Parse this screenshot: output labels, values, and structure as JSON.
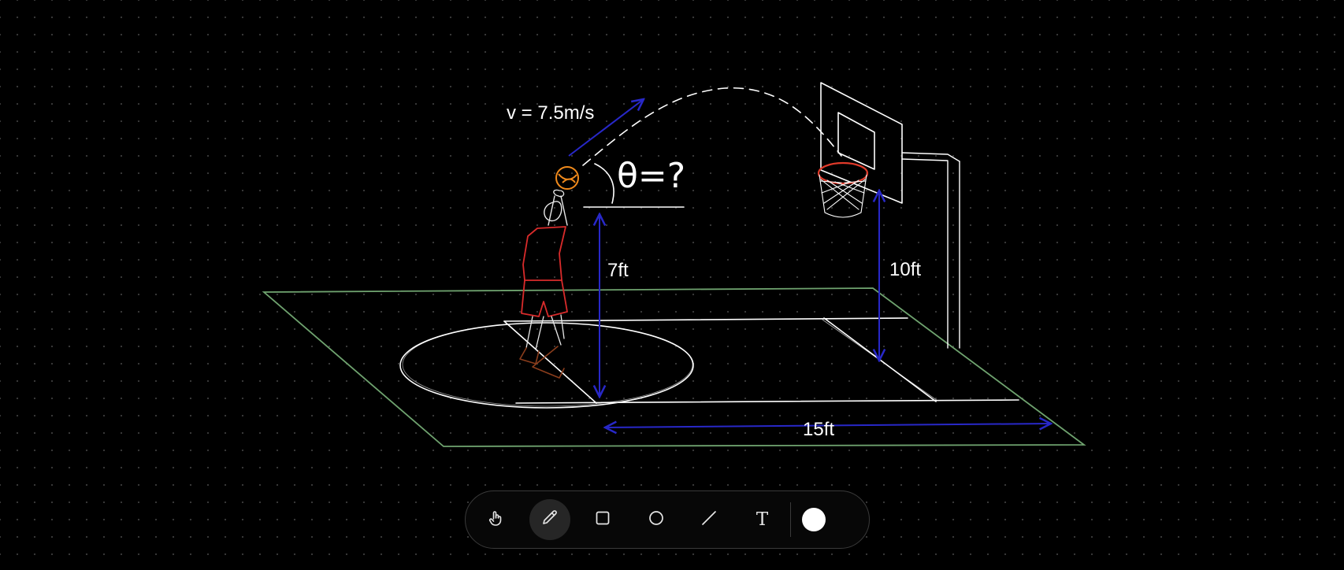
{
  "canvas": {
    "velocity_label": "v = 7.5m/s",
    "angle_label": "θ=?",
    "release_height_label": "7ft",
    "rim_height_label": "10ft",
    "distance_label": "15ft"
  },
  "colors": {
    "background": "#000000",
    "dot_grid": "#3a3a3a",
    "court_outline": "#6fa36f",
    "court_lines": "#ffffff",
    "dimension_arrows": "#2828c8",
    "player": "#d92b2b",
    "ball": "#f08a1c",
    "rim": "#e03a2a",
    "trajectory": "#ffffff"
  },
  "toolbar": {
    "tools": [
      {
        "name": "hand-tool",
        "icon": "hand-icon",
        "active": false
      },
      {
        "name": "pencil-tool",
        "icon": "pencil-icon",
        "active": true
      },
      {
        "name": "rectangle-tool",
        "icon": "square-icon",
        "active": false
      },
      {
        "name": "ellipse-tool",
        "icon": "circle-icon",
        "active": false
      },
      {
        "name": "line-tool",
        "icon": "line-icon",
        "active": false
      },
      {
        "name": "text-tool",
        "icon": "text-icon",
        "active": false
      }
    ],
    "text_tool_glyph": "T",
    "current_color": "#ffffff"
  }
}
